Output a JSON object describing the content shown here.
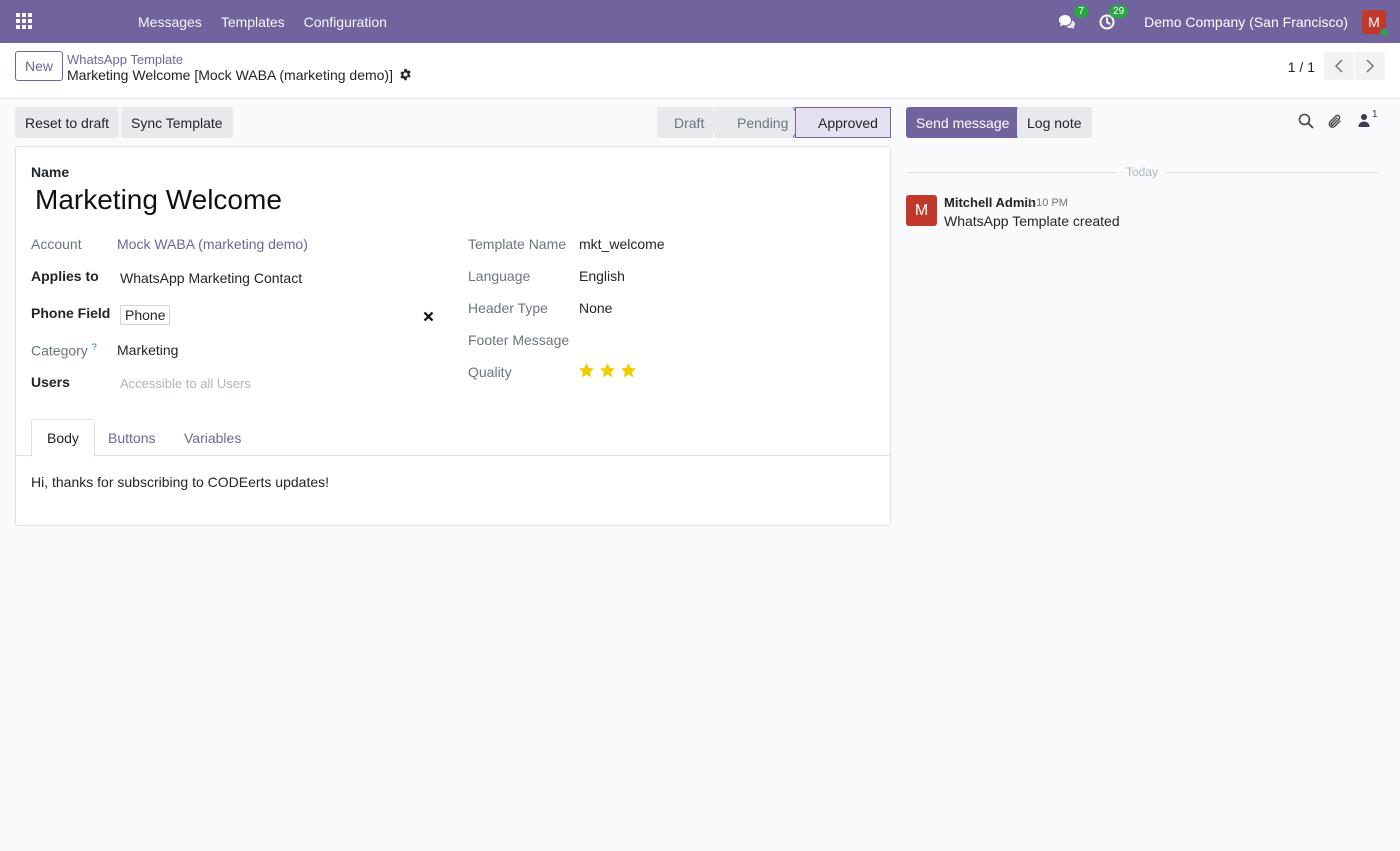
{
  "navbar": {
    "menu": [
      "Messages",
      "Templates",
      "Configuration"
    ],
    "messages_badge": "7",
    "activities_badge": "29",
    "company": "Demo Company (San Francisco)",
    "avatar_letter": "M"
  },
  "control": {
    "new_label": "New",
    "breadcrumb_parent": "WhatsApp Template",
    "breadcrumb_current": "Marketing Welcome [Mock WABA (marketing demo)]",
    "pager": "1 / 1"
  },
  "actions": {
    "reset_label": "Reset to draft",
    "sync_label": "Sync Template",
    "stages": [
      "Draft",
      "Pending",
      "Approved"
    ],
    "active_stage": "Approved"
  },
  "form": {
    "name_label": "Name",
    "name_value": "Marketing Welcome",
    "account_label": "Account",
    "account_value": "Mock WABA (marketing demo)",
    "applies_label": "Applies to",
    "applies_value": "WhatsApp Marketing Contact",
    "phone_label": "Phone Field",
    "phone_value": "Phone",
    "category_label": "Category",
    "category_help": "?",
    "category_value": "Marketing",
    "users_label": "Users",
    "users_placeholder": "Accessible to all Users",
    "template_name_label": "Template Name",
    "template_name_value": "mkt_welcome",
    "language_label": "Language",
    "language_value": "English",
    "header_type_label": "Header Type",
    "header_type_value": "None",
    "footer_label": "Footer Message",
    "quality_label": "Quality",
    "quality_stars": 3,
    "tabs": [
      "Body",
      "Buttons",
      "Variables"
    ],
    "active_tab": "Body",
    "body_text": "Hi, thanks for subscribing to CODEerts updates!"
  },
  "chatter": {
    "send_label": "Send message",
    "log_label": "Log note",
    "followers_count": "1",
    "today_label": "Today",
    "message": {
      "avatar_letter": "M",
      "author": "Mitchell Admin",
      "time": "1:10 PM",
      "body": "WhatsApp Template created"
    }
  },
  "colors": {
    "brand": "#71639e",
    "badge": "#28a745",
    "avatar": "#c0392b",
    "star": "#f3cc00"
  }
}
